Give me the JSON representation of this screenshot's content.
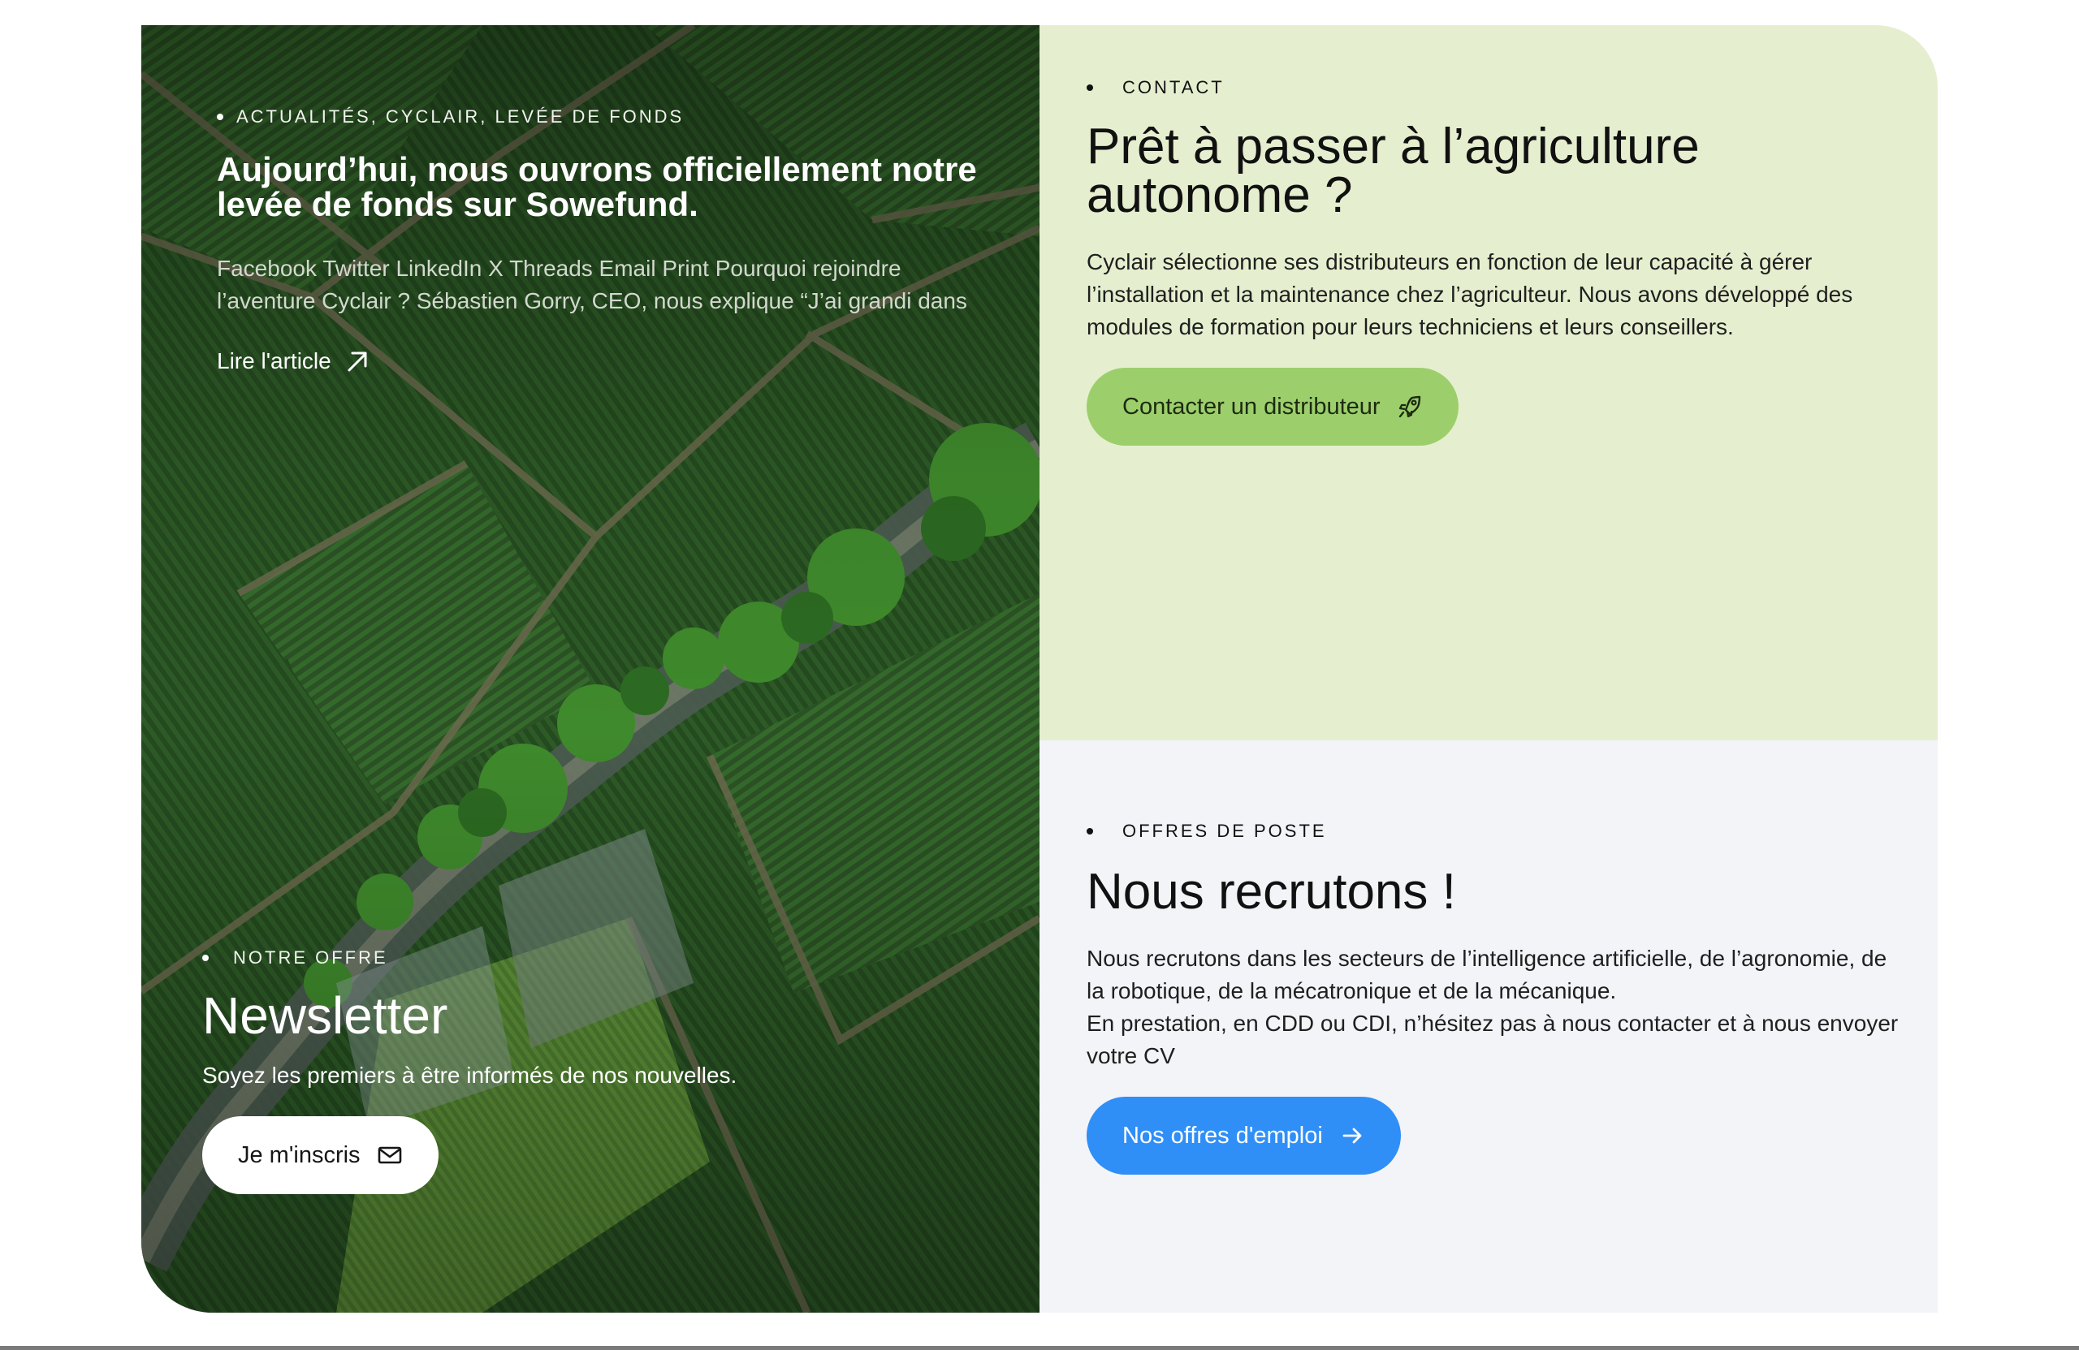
{
  "news": {
    "tags": "ACTUALITÉS, CYCLAIR, LEVÉE DE FONDS",
    "title": "Aujourd’hui, nous ouvrons officiellement notre levée de fonds sur Sowefund.",
    "excerpt": "Facebook Twitter LinkedIn X Threads Email Print Pourquoi rejoindre l’aventure Cyclair ? Sébastien Gorry, CEO, nous explique “J’ai grandi dans",
    "link_label": "Lire l'article",
    "link_icon": "arrow-up-right-icon"
  },
  "newsletter": {
    "eyebrow": "NOTRE OFFRE",
    "title": "Newsletter",
    "text": "Soyez les premiers à être informés de nos nouvelles.",
    "button_label": "Je m'inscris",
    "button_icon": "mail-icon"
  },
  "contact": {
    "eyebrow": "CONTACT",
    "title": "Prêt à passer à l’agriculture autonome ?",
    "text": "Cyclair sélectionne ses distributeurs en fonction de leur capacité à gérer l’installation et la maintenance chez l’agriculteur. Nous avons développé des modules de formation pour leurs techniciens et leurs conseillers.",
    "button_label": "Contacter un distributeur",
    "button_icon": "rocket-icon"
  },
  "jobs": {
    "eyebrow": "OFFRES DE POSTE",
    "title": "Nous recrutons !",
    "text_line1": "Nous recrutons dans les secteurs de l’intelligence artificielle, de l’agronomie, de la robotique, de la mécatronique et de la mécanique.",
    "text_line2": "En prestation, en CDD ou CDI, n’hésitez pas à nous contacter et à nous envoyer votre CV",
    "button_label": "Nos offres d'emploi",
    "button_icon": "arrow-right-icon"
  },
  "colors": {
    "contact_bg": "#e5efcf",
    "contact_button": "#9ccf6c",
    "jobs_bg": "#f3f4f8",
    "jobs_button": "#2f8ff7",
    "field_dark": "#1f3d1c"
  }
}
